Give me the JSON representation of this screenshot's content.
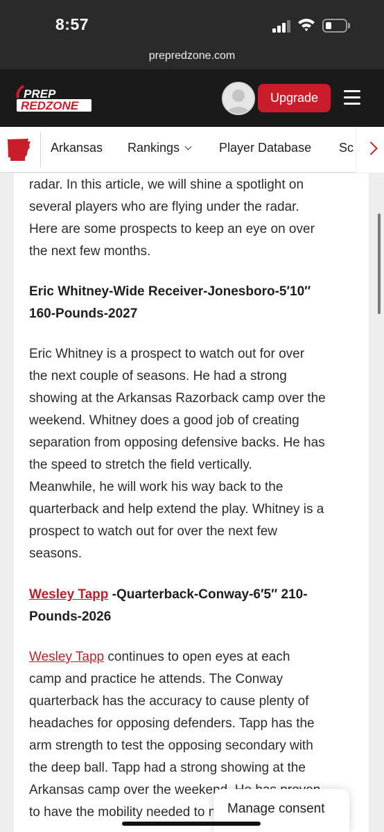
{
  "status_bar": {
    "time": "8:57"
  },
  "browser": {
    "url": "prepredzone.com"
  },
  "header": {
    "logo_line1": "PREP",
    "logo_line2": "REDZONE",
    "upgrade_label": "Upgrade",
    "brand_color": "#c91e2a"
  },
  "nav": {
    "items": [
      {
        "label": "Arkansas"
      },
      {
        "label": "Rankings"
      },
      {
        "label": "Player Database"
      },
      {
        "label": "Sc"
      }
    ]
  },
  "article": {
    "intro_lines": [
      "radar. In this article, we will shine a spotlight on",
      "several players who are flying under the radar.",
      "Here are some prospects to keep an eye on over",
      "the next few months."
    ],
    "player1_heading_lines": [
      "Eric Whitney-Wide Receiver-Jonesboro-5′10″",
      "160-Pounds-2027"
    ],
    "player1_paragraph_lines": [
      "Eric Whitney is a prospect to watch out for over",
      "the next couple of seasons. He had a strong",
      "showing at the Arkansas Razorback camp over the",
      "weekend. Whitney does a good job of creating",
      "separation from opposing defensive backs. He has",
      "the speed to stretch the field vertically.",
      "Meanwhile, he will work his way back to the",
      "quarterback and help extend the play. Whitney is a",
      "prospect to watch out for over the next few",
      "seasons."
    ],
    "player2_heading": {
      "link": "Wesley Tapp",
      "rest_line1": " -Quarterback-Conway-6′5″ 210-",
      "line2": "Pounds-2026"
    },
    "player2_paragraph": {
      "link": "Wesley Tapp",
      "first_rest": " continues to open eyes at each",
      "lines": [
        "camp and practice he attends. The Conway",
        "quarterback has the accuracy to cause plenty of",
        "headaches for opposing defenders. Tapp has the",
        "arm strength to test the opposing secondary with",
        "the deep ball. Tapp had a strong showing at the",
        "Arkansas camp over the weekend. He has proven",
        "to have the mobility needed to make plays for the"
      ]
    }
  },
  "consent": {
    "label": "Manage consent"
  }
}
